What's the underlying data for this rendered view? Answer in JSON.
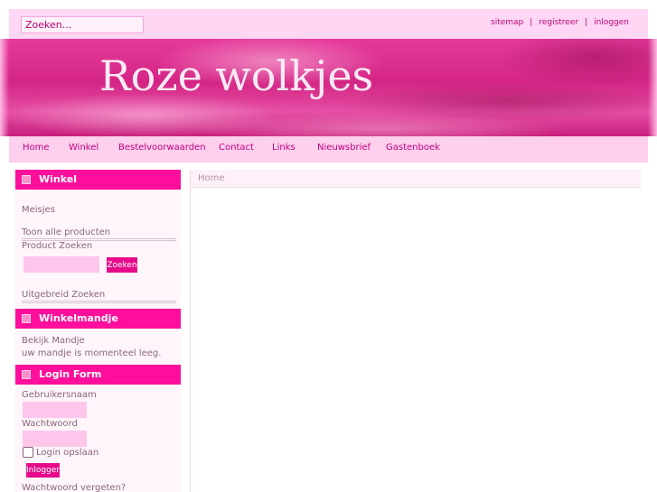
{
  "search": {
    "placeholder": "Zoeken..."
  },
  "top_links": [
    "sitemap",
    "registreer",
    "inloggen"
  ],
  "banner": {
    "title": "Roze wolkjes"
  },
  "nav": [
    "Home",
    "Winkel",
    "Bestelvoorwaarden",
    "Contact",
    "Links",
    "Nieuwsbrief",
    "Gastenboek"
  ],
  "sidebar": {
    "winkel": {
      "title": "Winkel",
      "category": "Meisjes",
      "all_products": "Toon alle producten",
      "product_search_label": "Product Zoeken",
      "search_button": "Zoeken",
      "advanced_search": "Uitgebreid Zoeken"
    },
    "cart": {
      "title": "Winkelmandje",
      "view_cart": "Bekijk Mandje",
      "empty_message": "uw mandje is momenteel leeg."
    },
    "login": {
      "title": "Login Form",
      "username_label": "Gebruikersnaam",
      "password_label": "Wachtwoord",
      "remember_label": "Login opslaan",
      "login_button": "Inloggen",
      "forgot_password": "Wachtwoord vergeten?"
    }
  },
  "main": {
    "breadcrumb": "Home"
  },
  "colors": {
    "accent": "#ff0f9b",
    "nav_bg": "#ffcfee",
    "link": "#c2007a"
  }
}
